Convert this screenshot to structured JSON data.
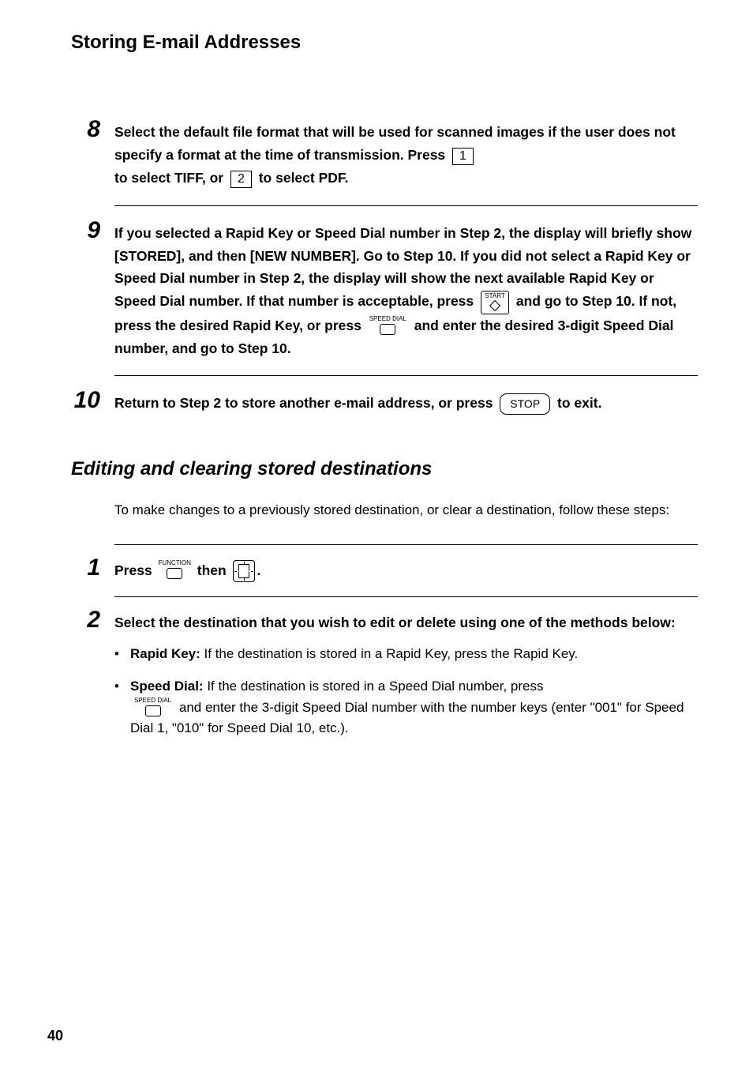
{
  "title": "Storing E-mail Addresses",
  "step8": {
    "num": "8",
    "line1a": "Select the default file format that will be used for scanned images if the ",
    "line2a": "user does not specify a format at the time of transmission. Press ",
    "key1": "1",
    "line3a": "to select TIFF, or ",
    "key2": "2",
    "line3b": " to select PDF."
  },
  "step9": {
    "num": "9",
    "para1": "If you  selected a Rapid Key or Speed Dial number in Step 2, the display will briefly show [STORED], and then [NEW NUMBER]. Go to Step 10. If you did not select a Rapid Key or Speed Dial number in Step 2, the display will show the next available Rapid Key or Speed Dial number. If ",
    "line2a": "that number is acceptable, press ",
    "startLabel": "START",
    "line2b": " and go to Step 10. If not, press ",
    "line3a": "the desired Rapid Key, or press ",
    "speedDialLabel": "SPEED DIAL",
    "line3b": " and enter the desired 3-digit ",
    "line4": "Speed Dial number, and go to Step 10."
  },
  "step10": {
    "num": "10",
    "textA": "Return to Step 2 to store another e-mail address, or press ",
    "stopLabel": "STOP",
    "textB": " to exit."
  },
  "section2": {
    "heading": "Editing and clearing stored destinations",
    "intro": "To make changes to a previously stored destination, or clear a destination, follow these steps:"
  },
  "step1": {
    "num": "1",
    "textA": "Press ",
    "functionLabel": "FUNCTION",
    "textB": " then ",
    "textC": "."
  },
  "step2": {
    "num": "2",
    "textA": "Select the destination that you wish to edit or delete using one of the methods below:",
    "bullet1Label": "Rapid Key:",
    "bullet1Text": " If the destination is stored in a Rapid Key, press the Rapid Key.",
    "bullet2Label": "Speed Dial:",
    "bullet2TextA": " If the destination is stored in a Speed Dial number, press ",
    "bullet2SpeedDial": "SPEED DIAL",
    "bullet2TextB": " and enter the 3-digit Speed Dial number with the number keys (enter \"001\" for Speed Dial 1, \"010\" for Speed Dial 10, etc.)."
  },
  "pageNumber": "40"
}
